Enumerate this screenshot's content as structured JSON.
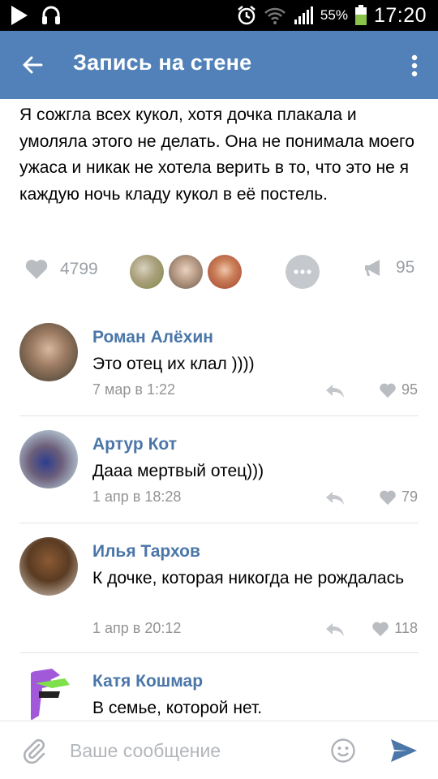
{
  "status_bar": {
    "battery_percent": "55%",
    "time": "17:20",
    "icons": [
      "play-icon",
      "headset-icon",
      "alarm-icon",
      "wifi-icon",
      "signal-icon",
      "battery-icon"
    ]
  },
  "header": {
    "title": "Запись на стене",
    "back_icon": "arrow-left-icon",
    "menu_icon": "more-vertical-icon"
  },
  "post": {
    "text": "Я сожгла всех кукол, хотя дочка плакала и умоляла этого не делать. Она не понимала моего ужаса и никак не хотела верить в то, что это не я каждую ночь кладу кукол в её постель.",
    "likes": "4799",
    "shares": "95"
  },
  "comments": [
    {
      "author": "Роман Алёхин",
      "text": "Это отец их клал ))))",
      "date": "7 мар в 1:22",
      "likes": "95"
    },
    {
      "author": "Артур Кот",
      "text": "Дааа мертвый отец)))",
      "date": "1 апр в 18:28",
      "likes": "79"
    },
    {
      "author": "Илья Тархов",
      "text": "К дочке, которая никогда не рождалась",
      "date": "1 апр в 20:12",
      "likes": "118"
    },
    {
      "author": "Катя Кошмар",
      "text": "В семье, которой нет.",
      "date": "",
      "likes": ""
    }
  ],
  "composer": {
    "placeholder": "Ваше сообщение"
  },
  "colors": {
    "header_bg": "#5181b8",
    "author_name": "#4a76a8",
    "send_accent": "#4a76a8",
    "meta_gray": "#939393"
  }
}
